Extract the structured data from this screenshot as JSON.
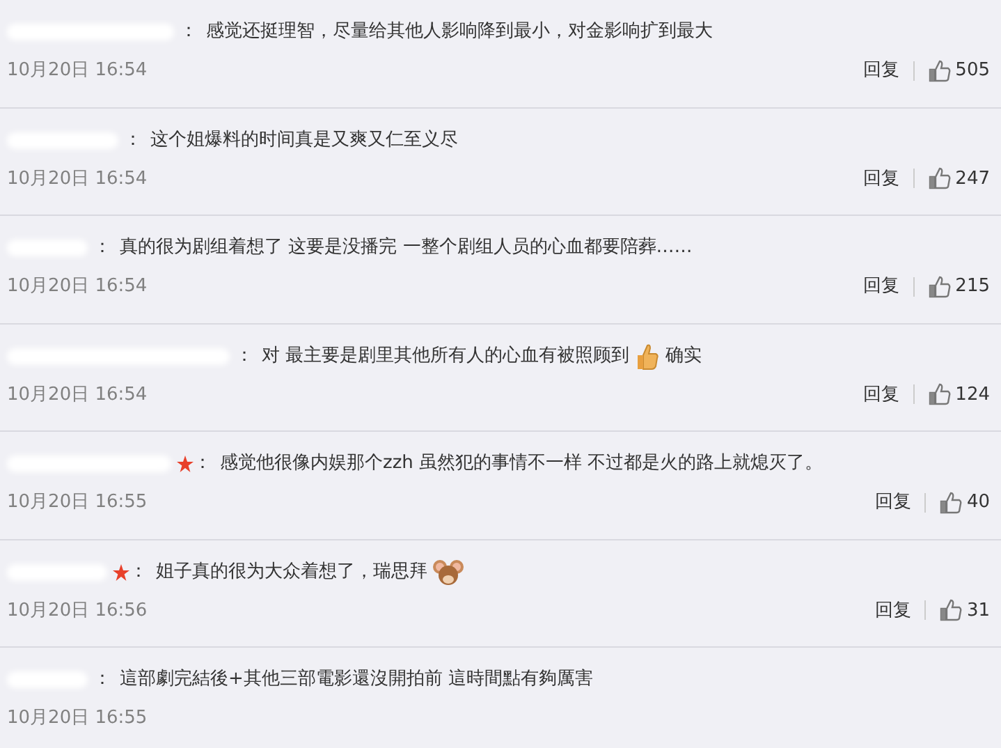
{
  "comments": [
    {
      "badge": false,
      "segments": [
        {
          "kind": "text",
          "text": "感觉还挺理智，尽量给其他人影响降到最小，对金影响扩到最大"
        }
      ],
      "time": "10月20日 16:54",
      "reply": "回复",
      "likes": "505"
    },
    {
      "badge": false,
      "segments": [
        {
          "kind": "text",
          "text": "这个姐爆料的时间真是又爽又仁至义尽"
        }
      ],
      "time": "10月20日 16:54",
      "reply": "回复",
      "likes": "247"
    },
    {
      "badge": false,
      "segments": [
        {
          "kind": "text",
          "text": "真的很为剧组着想了 这要是没播完 一整个剧组人员的心血都要陪葬……"
        }
      ],
      "time": "10月20日 16:54",
      "reply": "回复",
      "likes": "215"
    },
    {
      "badge": false,
      "segments": [
        {
          "kind": "text",
          "text": "对 最主要是剧里其他所有人的心血有被照顾到"
        },
        {
          "kind": "thumb"
        },
        {
          "kind": "text",
          "text": "确实"
        }
      ],
      "time": "10月20日 16:54",
      "reply": "回复",
      "likes": "124"
    },
    {
      "badge": true,
      "segments": [
        {
          "kind": "text",
          "text": "感觉他很像内娱那个zzh 虽然犯的事情不一样 不过都是火的路上就熄灭了。"
        }
      ],
      "time": "10月20日 16:55",
      "reply": "回复",
      "likes": "40"
    },
    {
      "badge": true,
      "segments": [
        {
          "kind": "text",
          "text": "姐子真的很为大众着想了，瑞思拜"
        },
        {
          "kind": "mouse"
        }
      ],
      "time": "10月20日 16:56",
      "reply": "回复",
      "likes": "31"
    },
    {
      "badge": false,
      "segments": [
        {
          "kind": "text",
          "text": "這部劇完結後+其他三部電影還沒開拍前 這時間點有夠厲害"
        }
      ],
      "time": "10月20日 16:55"
    }
  ],
  "separator": "："
}
